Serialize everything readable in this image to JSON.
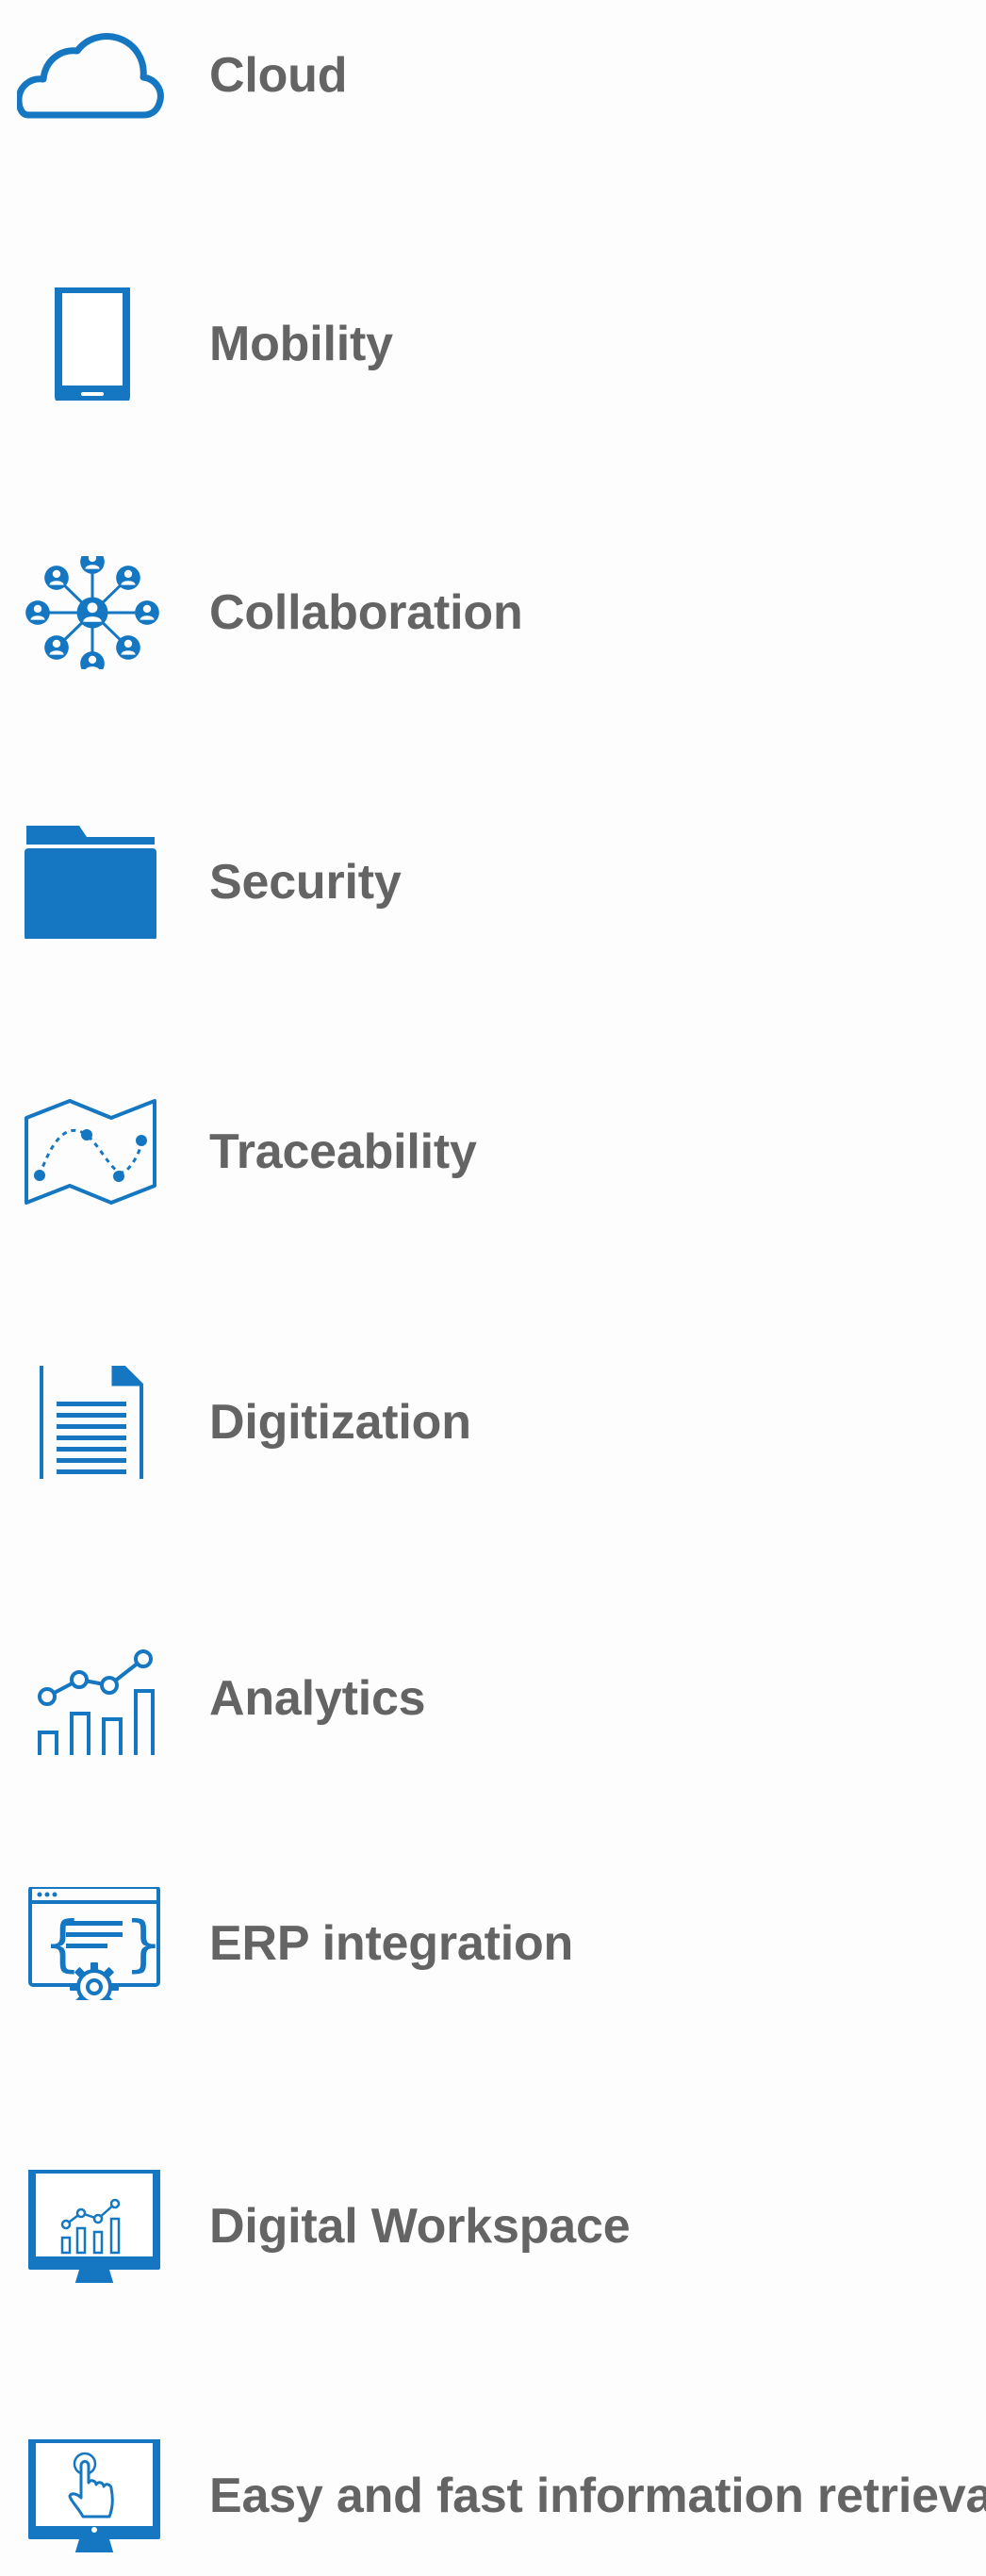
{
  "theme": {
    "icon_color": "#1577c1",
    "text_color": "#646464",
    "background": "#fdfdfd"
  },
  "features": [
    {
      "label": "Cloud",
      "icon": "cloud-icon"
    },
    {
      "label": "Mobility",
      "icon": "smartphone-icon"
    },
    {
      "label": "Collaboration",
      "icon": "people-network-icon"
    },
    {
      "label": "Security",
      "icon": "folder-icon"
    },
    {
      "label": "Traceability",
      "icon": "map-route-icon"
    },
    {
      "label": "Digitization",
      "icon": "document-icon"
    },
    {
      "label": "Analytics",
      "icon": "analytics-chart-icon"
    },
    {
      "label": "ERP integration",
      "icon": "erp-gear-window-icon"
    },
    {
      "label": "Digital Workspace",
      "icon": "monitor-chart-icon"
    },
    {
      "label": "Easy and fast information retrieval",
      "icon": "touch-screen-icon"
    }
  ]
}
